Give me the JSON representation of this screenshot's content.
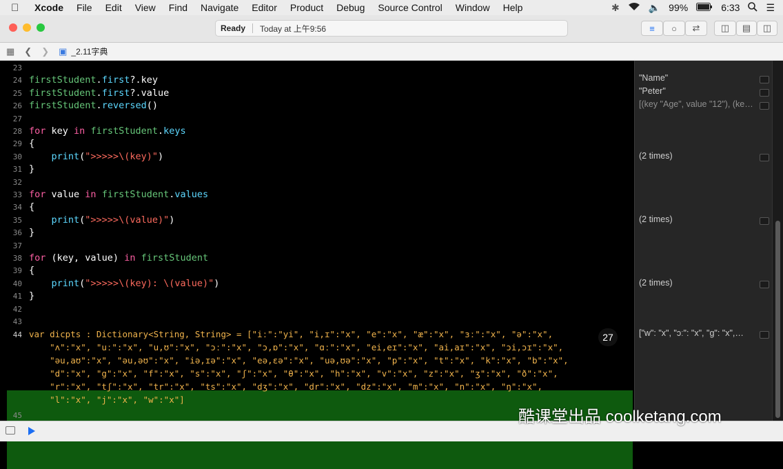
{
  "menubar": {
    "app": "Xcode",
    "items": [
      "File",
      "Edit",
      "View",
      "Find",
      "Navigate",
      "Editor",
      "Product",
      "Debug",
      "Source Control",
      "Window",
      "Help"
    ],
    "battery": "99%",
    "time": "6:33"
  },
  "titlebar": {
    "status": "Ready",
    "timestamp": "Today at 上午9:56"
  },
  "navbar": {
    "file": "_2.11字典"
  },
  "code_lines": [
    {
      "n": "23",
      "code": ""
    },
    {
      "n": "24",
      "code": "firstStudent.first?.key"
    },
    {
      "n": "25",
      "code": "firstStudent.first?.value"
    },
    {
      "n": "26",
      "code": "firstStudent.reversed()"
    },
    {
      "n": "27",
      "code": ""
    },
    {
      "n": "28",
      "code": "for key in firstStudent.keys"
    },
    {
      "n": "29",
      "code": "{"
    },
    {
      "n": "30",
      "code": "    print(\">>>>>\\(key)\")"
    },
    {
      "n": "31",
      "code": "}"
    },
    {
      "n": "32",
      "code": ""
    },
    {
      "n": "33",
      "code": "for value in firstStudent.values"
    },
    {
      "n": "34",
      "code": "{"
    },
    {
      "n": "35",
      "code": "    print(\">>>>>\\(value)\")"
    },
    {
      "n": "36",
      "code": "}"
    },
    {
      "n": "37",
      "code": ""
    },
    {
      "n": "38",
      "code": "for (key, value) in firstStudent"
    },
    {
      "n": "39",
      "code": "{"
    },
    {
      "n": "40",
      "code": "    print(\">>>>>\\(key): \\(value)\")"
    },
    {
      "n": "41",
      "code": "}"
    },
    {
      "n": "42",
      "code": ""
    },
    {
      "n": "43",
      "code": ""
    }
  ],
  "highlight": {
    "line_number": "44",
    "next_line_number": "45",
    "lines": [
      "var dicpts : Dictionary<String, String> = [\"iː\":\"yi\", \"i,ɪ\":\"x\", \"e\":\"x\", \"æ\":\"x\", \"ɜː\":\"x\", \"ə\":\"x\",",
      "    \"ʌ\":\"x\", \"uː\":\"x\", \"u,ʊ\":\"x\", \"ɔː\":\"x\", \"ɔ,ɒ\":\"x\", \"ɑː\":\"x\", \"ei,eɪ\":\"x\", \"ai,aɪ\":\"x\", \"ɔi,ɔɪ\":\"x\",",
      "    \"əu,aʊ\":\"x\", \"əu,əʊ\":\"x\", \"iə,ɪə\":\"x\", \"eə,ɛə\":\"x\", \"uə,ʊə\":\"x\", \"p\":\"x\", \"t\":\"x\", \"k\":\"x\", \"b\":\"x\",",
      "    \"d\":\"x\", \"g\":\"x\", \"f\":\"x\", \"s\":\"x\", \"ʃ\":\"x\", \"θ\":\"x\", \"h\":\"x\", \"v\":\"x\", \"z\":\"x\", \"ʒ\":\"x\", \"ð\":\"x\",",
      "    \"r\":\"x\", \"tʃ\":\"x\", \"tr\":\"x\", \"ts\":\"x\", \"dʒ\":\"x\", \"dr\":\"x\", \"dz\":\"x\", \"m\":\"x\", \"n\":\"x\", \"ŋ\":\"x\",",
      "    \"l\":\"x\", \"j\":\"x\", \"w\":\"x\"]"
    ],
    "count_badge": "27"
  },
  "results": {
    "r24": "\"Name\"",
    "r25": "\"Peter\"",
    "r26": "[(key \"Age\", value \"12\"), (key…",
    "r30": "(2 times)",
    "r35": "(2 times)",
    "r40": "(2 times)",
    "r44": "[\"w\": \"x\", \"ɔː\": \"x\", \"g\": \"x\",…"
  },
  "watermark": "酷课堂出品 coolketang.com"
}
